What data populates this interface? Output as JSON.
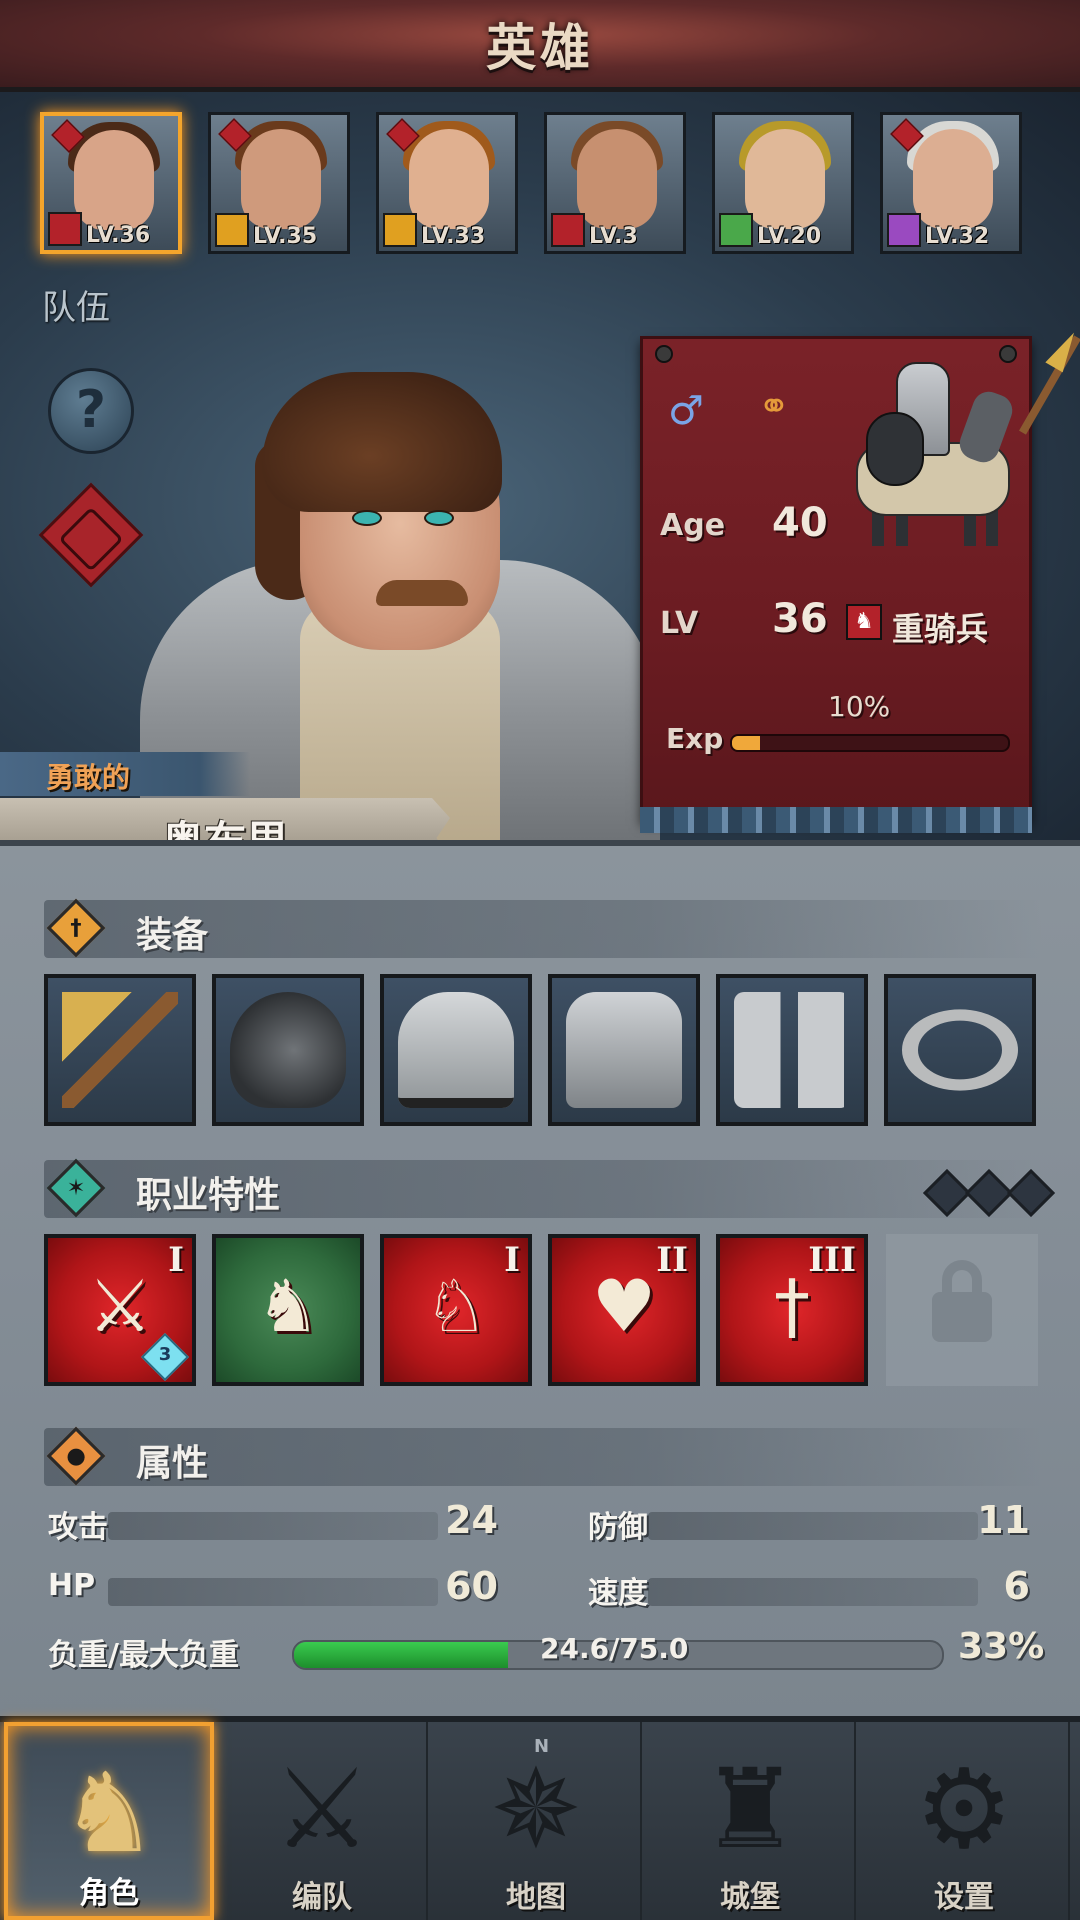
{
  "header": {
    "title": "英雄"
  },
  "roster": [
    {
      "level": "LV.36",
      "class_icon": "horse-icon",
      "class_color": "#b3222a",
      "hair": "#4b2a18",
      "skin": "#d8a488",
      "selected": true,
      "sealed": true
    },
    {
      "level": "LV.35",
      "class_icon": "shield-icon",
      "class_color": "#e0a020",
      "hair": "#6a3a1c",
      "skin": "#cf9a7c",
      "selected": false,
      "sealed": true
    },
    {
      "level": "LV.33",
      "class_icon": "shield-icon",
      "class_color": "#e0a020",
      "hair": "#a05a1c",
      "skin": "#e0b090",
      "selected": false,
      "sealed": true
    },
    {
      "level": "LV.3",
      "class_icon": "horse-icon",
      "class_color": "#b3222a",
      "hair": "#7a4a28",
      "skin": "#c79070",
      "selected": false,
      "sealed": false
    },
    {
      "level": "LV.20",
      "class_icon": "bow-icon",
      "class_color": "#4aa84a",
      "hair": "#b89a2a",
      "skin": "#e0b898",
      "selected": false,
      "sealed": false
    },
    {
      "level": "LV.32",
      "class_icon": "staff-icon",
      "class_color": "#9a4ac0",
      "hair": "#d8d8d4",
      "skin": "#dcae92",
      "selected": false,
      "sealed": true
    }
  ],
  "team_label": "队伍",
  "help_glyph": "?",
  "hero": {
    "trait_title": "勇敢的",
    "name": "奥布里",
    "age_label": "Age",
    "age": "40",
    "lv_label": "LV",
    "level": "36",
    "class_name": "重骑兵",
    "exp_label": "Exp",
    "exp_percent": "10%",
    "exp_fraction": 0.1,
    "gender_glyph": "♂",
    "marital_glyph": "⚭"
  },
  "sections": {
    "equipment": "装备",
    "traits": "职业特性",
    "attributes": "属性"
  },
  "equipment": [
    {
      "icon": "spear-icon"
    },
    {
      "icon": "shield-icon"
    },
    {
      "icon": "helmet-icon"
    },
    {
      "icon": "armor-icon"
    },
    {
      "icon": "boots-icon"
    },
    {
      "icon": "ring-icon"
    }
  ],
  "traits": [
    {
      "icon": "sword-cursor-icon",
      "glyph": "⚔",
      "rank": "I",
      "badge": "3",
      "color": "red"
    },
    {
      "icon": "charging-horse-icon",
      "glyph": "♞",
      "rank": "",
      "badge": "",
      "color": "green"
    },
    {
      "icon": "strength-horse-icon",
      "glyph": "♘",
      "rank": "I",
      "badge": "",
      "color": "red"
    },
    {
      "icon": "heartbeat-icon",
      "glyph": "♥",
      "rank": "II",
      "badge": "",
      "color": "red"
    },
    {
      "icon": "sword-icon",
      "glyph": "†",
      "rank": "III",
      "badge": "",
      "color": "red"
    }
  ],
  "trait_pips": 3,
  "attributes": {
    "attack_label": "攻击",
    "attack": "24",
    "defense_label": "防御",
    "defense": "11",
    "hp_label": "HP",
    "hp": "60",
    "speed_label": "速度",
    "speed": "6",
    "weight_label": "负重/最大负重",
    "weight_text": "24.6/75.0",
    "weight_percent": "33%",
    "weight_fraction": 0.33
  },
  "nav": [
    {
      "label": "角色",
      "icon": "knight-icon",
      "glyph": "♞",
      "active": true
    },
    {
      "label": "编队",
      "icon": "formation-icon",
      "glyph": "⚔",
      "active": false
    },
    {
      "label": "地图",
      "icon": "compass-icon",
      "glyph": "✵",
      "active": false
    },
    {
      "label": "城堡",
      "icon": "castle-icon",
      "glyph": "♜",
      "active": false
    },
    {
      "label": "设置",
      "icon": "gear-icon",
      "glyph": "⚙",
      "active": false
    }
  ],
  "compass_n": "N"
}
